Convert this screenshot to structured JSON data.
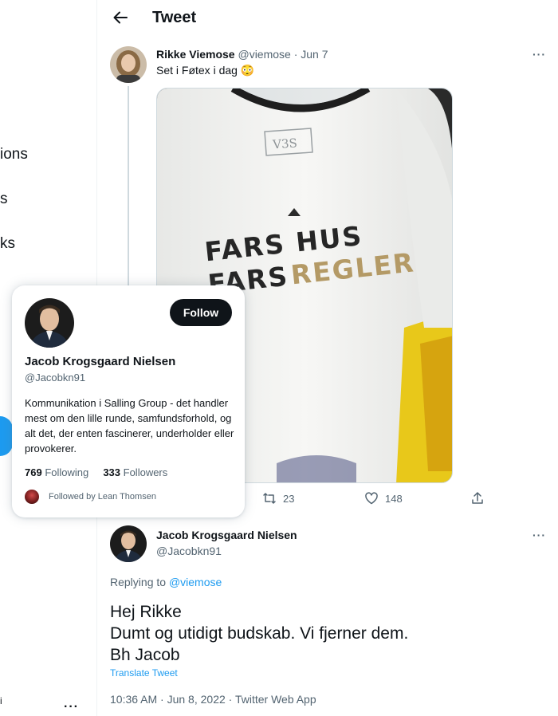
{
  "nav": {
    "items": [
      "ions",
      "s",
      "ks"
    ],
    "account_fragment": "i",
    "more": "···"
  },
  "header": {
    "title": "Tweet"
  },
  "tweet": {
    "author_name": "Rikke Viemose",
    "author_handle": "@viemose",
    "date": "· Jun 7",
    "text": "Set i Føtex i dag 😳",
    "image": {
      "label_tag": "V3S",
      "line1": "FARS HUS",
      "line2a": "FARS",
      "line2b": "REGLER"
    },
    "retweets": "23",
    "likes": "148",
    "more": "···"
  },
  "reply": {
    "author_name": "Jacob Krogsgaard Nielsen",
    "author_handle": "@Jacobkn91",
    "replying_to_label": "Replying to",
    "replying_to_handle": "@viemose",
    "lines": [
      "Hej Rikke",
      "Dumt og utidigt budskab. Vi fjerner dem.",
      "Bh Jacob"
    ],
    "translate": "Translate Tweet",
    "meta": "10:36 AM · Jun 8, 2022 · Twitter Web App",
    "more": "···"
  },
  "hover_card": {
    "name": "Jacob Krogsgaard Nielsen",
    "handle": "@Jacobkn91",
    "follow_label": "Follow",
    "bio": "Kommunikation i Salling Group - det handler mest om den lille runde, samfundsforhold, og alt det, der enten fascinerer, underholder eller provokerer.",
    "following_count": "769",
    "following_label": "Following",
    "followers_count": "333",
    "followers_label": "Followers",
    "followed_by": "Followed by Lean Thomsen"
  },
  "colors": {
    "accent": "#1d9bf0",
    "text": "#0f1419",
    "muted": "#536471",
    "print_gold": "#b49a66"
  }
}
